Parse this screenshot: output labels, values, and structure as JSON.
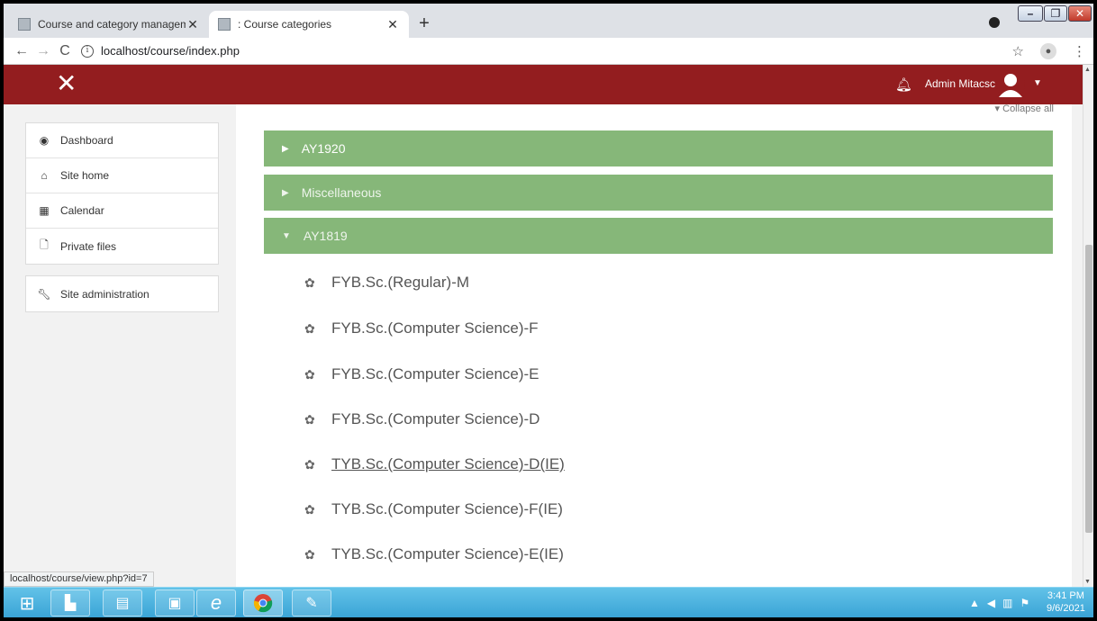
{
  "browser": {
    "tabs": [
      {
        "title": "Course and category manageme",
        "active": false
      },
      {
        "title": ": Course categories",
        "active": true
      }
    ],
    "new_tab": "+",
    "url": "localhost/course/index.php",
    "status_url": "localhost/course/view.php?id=7"
  },
  "navbar": {
    "close_glyph": "✕",
    "user_name": "Admin Mitacsc",
    "brand_color": "#931d1f"
  },
  "sidebar": {
    "items": [
      {
        "label": "Dashboard",
        "icon": "dashboard-icon"
      },
      {
        "label": "Site home",
        "icon": "home-icon"
      },
      {
        "label": "Calendar",
        "icon": "calendar-icon"
      },
      {
        "label": "Private files",
        "icon": "file-icon"
      }
    ],
    "admin": {
      "label": "Site administration",
      "icon": "wrench-icon"
    }
  },
  "main": {
    "collapse_all": "Collapse all",
    "categories": [
      {
        "name": "AY1920",
        "expanded": false
      },
      {
        "name": "Miscellaneous",
        "expanded": false
      },
      {
        "name": "AY1819",
        "expanded": true
      }
    ],
    "courses": [
      "FYB.Sc.(Regular)-M",
      "FYB.Sc.(Computer Science)-F",
      "FYB.Sc.(Computer Science)-E",
      "FYB.Sc.(Computer Science)-D",
      "TYB.Sc.(Computer Science)-D(IE)",
      "TYB.Sc.(Computer Science)-F(IE)",
      "TYB.Sc.(Computer Science)-E(IE)"
    ],
    "category_color": "#86b779"
  },
  "taskbar": {
    "time": "3:41 PM",
    "date": "9/6/2021"
  }
}
